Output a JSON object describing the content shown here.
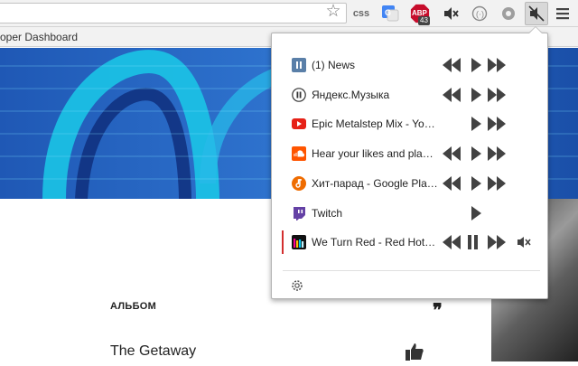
{
  "toolbar": {
    "css_label": "css",
    "abp_label": "ABP",
    "abp_count": "43"
  },
  "bookmarks": {
    "item_text": "oper Dashboard"
  },
  "page": {
    "album_label": "АЛЬБОМ",
    "album_title": "The Getaway"
  },
  "popup": {
    "tabs": [
      {
        "title": "(1) News",
        "source": "news",
        "controls": [
          "prev",
          "play",
          "next"
        ]
      },
      {
        "title": "Яндекс.Музыка",
        "source": "yandex",
        "controls": [
          "prev",
          "play",
          "next"
        ]
      },
      {
        "title": "Epic Metalstep Mix - Yo…",
        "source": "youtube",
        "controls": [
          "play",
          "next"
        ]
      },
      {
        "title": "Hear your likes and play…",
        "source": "soundcloud",
        "controls": [
          "prev",
          "play",
          "next"
        ]
      },
      {
        "title": "Хит-парад - Google Pla…",
        "source": "google-play",
        "controls": [
          "prev",
          "play",
          "next"
        ]
      },
      {
        "title": "Twitch",
        "source": "twitch",
        "controls": [
          "play"
        ]
      },
      {
        "title": "We Turn Red - Red Hot …",
        "source": "deezer",
        "controls": [
          "prev",
          "pause",
          "next",
          "mute"
        ],
        "active": true
      }
    ]
  },
  "colors": {
    "youtube": "#e62117",
    "soundcloud": "#ff5500",
    "google_play": "#ef6c00",
    "twitch": "#6441a5",
    "active_bar": "#d32f2f",
    "control": "#424242"
  }
}
